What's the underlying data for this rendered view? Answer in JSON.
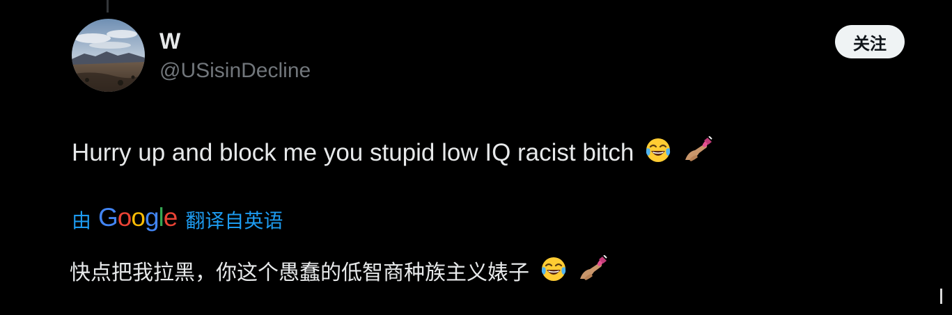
{
  "tweet": {
    "display_name": "W",
    "handle": "@USisinDecline",
    "follow_label": "关注",
    "text": "Hurry up and block me you stupid low IQ racist bitch",
    "emojis": [
      "face-with-tears-of-joy-icon",
      "nail-polish-icon"
    ]
  },
  "translation": {
    "prefix": "由",
    "provider": [
      "G",
      "o",
      "o",
      "g",
      "l",
      "e"
    ],
    "provider_colors": [
      "#4285f4",
      "#ea4335",
      "#fbbc05",
      "#4285f4",
      "#34a853",
      "#ea4335"
    ],
    "suffix": "翻译自英语",
    "text": "快点把我拉黑，你这个愚蠢的低智商种族主义婊子"
  },
  "colors": {
    "background": "#000000",
    "primary_text": "#e7e9ea",
    "secondary_text": "#71767b",
    "link": "#1d9bf0",
    "button_bg": "#eff3f4"
  }
}
